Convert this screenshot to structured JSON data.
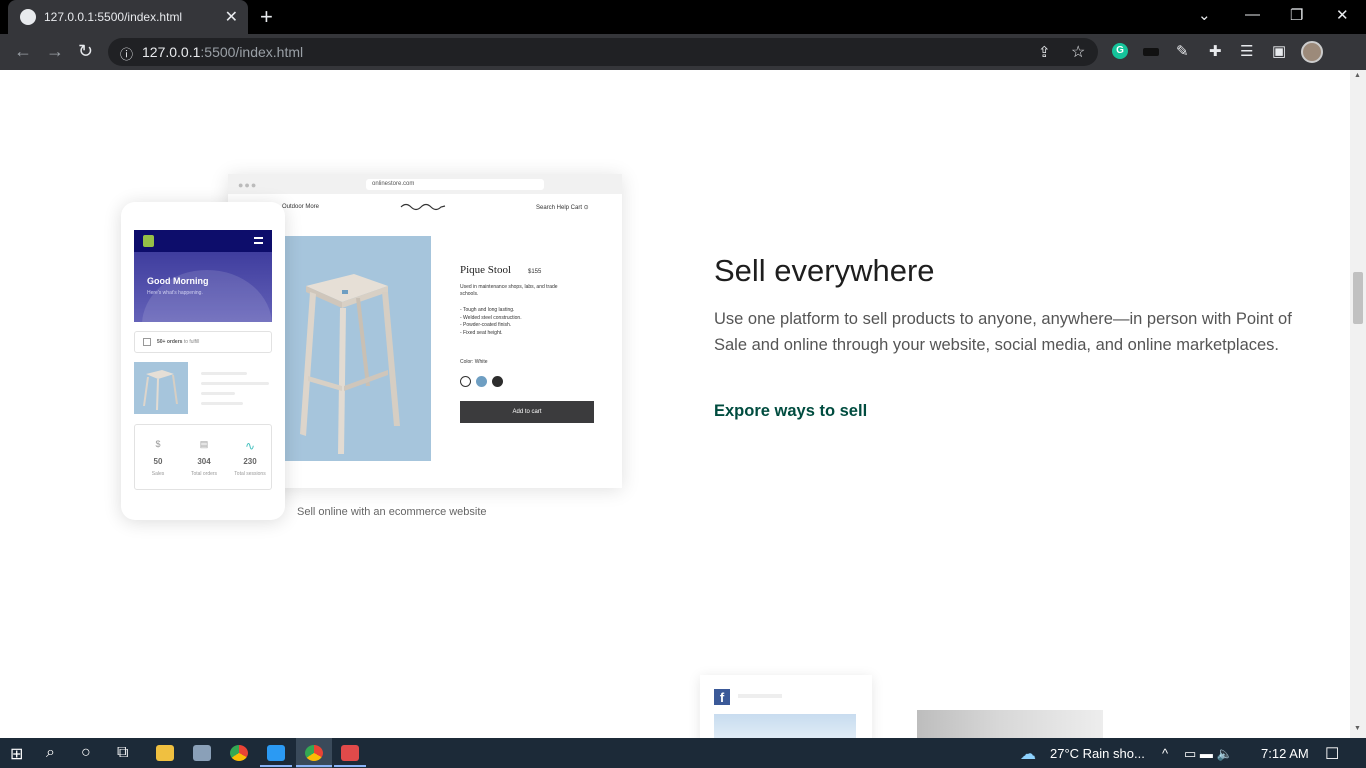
{
  "browser": {
    "tab_title": "127.0.0.1:5500/index.html",
    "tab_close": "✕",
    "new_tab": "+",
    "url_host": "127.0.0.1",
    "url_rest": ":5500/index.html",
    "win_min": "—",
    "win_max": "❐",
    "win_close": "✕",
    "chevron": "⌄"
  },
  "icons": {
    "back": "←",
    "forward": "→",
    "reload": "↻",
    "info": "ⓘ",
    "share": "⇪",
    "star": "☆",
    "grammarly": "G",
    "pen": "✎",
    "puzzle": "✚",
    "media": "☰",
    "panel": "▣"
  },
  "desktop_mock": {
    "dots": "●●●",
    "url": "onlinestore.com",
    "nav_left": "Outdoor   More",
    "nav_right": "Search   Help   Cart  ⊙",
    "product_name": "Pique Stool",
    "price": "$155",
    "description": "Used in maintenance shops, labs, and trade schools.",
    "bullets": [
      "- Tough and long lasting.",
      "- Welded steel construction.",
      "- Powder-coated finish.",
      "- Fixed seat height."
    ],
    "color_label": "Color: White",
    "add_to_cart": "Add to cart"
  },
  "phone_mock": {
    "greeting": "Good Morning",
    "subtitle": "Here's what's happening.",
    "orders_count": "50+ orders",
    "orders_suffix": " to fulfill",
    "stats": [
      {
        "icon": "$",
        "value": "50",
        "label": "Sales"
      },
      {
        "icon": "▤",
        "value": "304",
        "label": "Total orders"
      },
      {
        "icon": "∿",
        "value": "230",
        "label": "Total sessions"
      }
    ]
  },
  "caption": "Sell online with an ecommerce website",
  "section": {
    "heading": "Sell everywhere",
    "body": "Use one platform to sell products to anyone, anywhere—in person with Point of Sale and online through your website, social media, and online marketplaces.",
    "cta": "Expore ways to sell"
  },
  "facebook_card": {
    "icon": "f"
  },
  "taskbar": {
    "weather": "27°C  Rain sho...",
    "time": "7:12 AM",
    "start": "⊞",
    "search": "⌕",
    "cortana": "○",
    "taskview": "⧉",
    "tray_up": "^",
    "tray_icons": "▭  ▬  🔈",
    "notifications": "☐",
    "weather_icon": "☁"
  },
  "colors": {
    "accent_green": "#004c3f",
    "phone_header": "#0d0d6b",
    "stool_bg": "#a6c5dc",
    "button_dark": "#3b3b3d"
  }
}
